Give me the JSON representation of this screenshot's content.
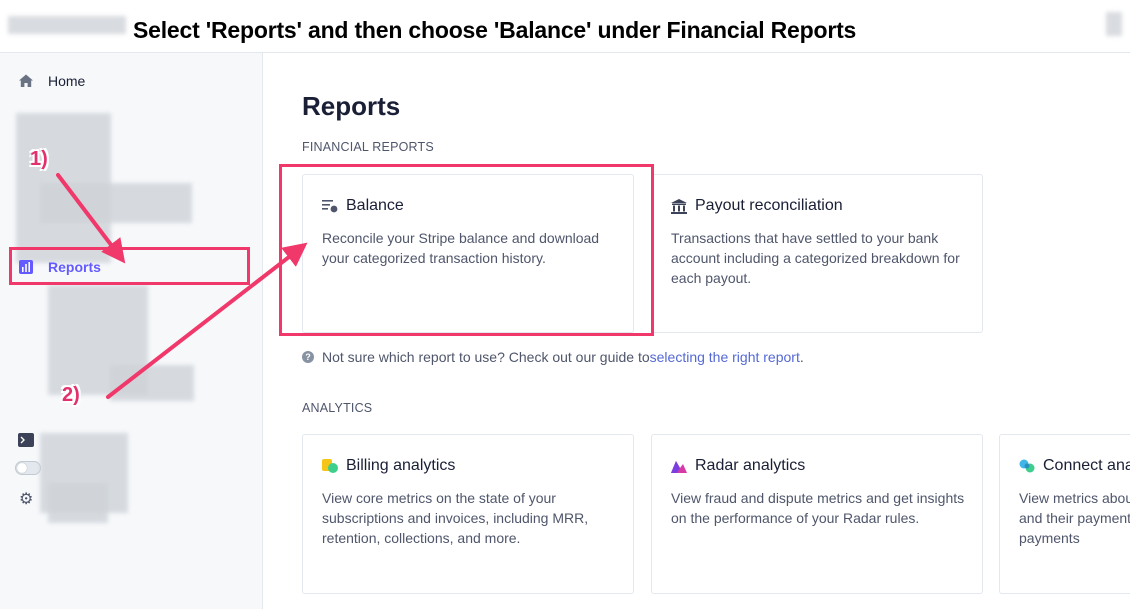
{
  "instruction": "Select 'Reports' and then choose 'Balance' under Financial Reports",
  "sidebar": {
    "home_label": "Home",
    "reports_label": "Reports"
  },
  "main": {
    "page_title": "Reports",
    "financial_label": "FINANCIAL REPORTS",
    "analytics_label": "ANALYTICS",
    "cards": {
      "balance": {
        "title": "Balance",
        "desc": "Reconcile your Stripe balance and download your categorized transaction history."
      },
      "payout": {
        "title": "Payout reconciliation",
        "desc": "Transactions that have settled to your bank account including a categorized breakdown for each payout."
      },
      "billing": {
        "title": "Billing analytics",
        "desc": "View core metrics on the state of your subscriptions and invoices, including MRR, retention, collections, and more."
      },
      "radar": {
        "title": "Radar analytics",
        "desc": "View fraud and dispute metrics and get insights on the performance of your Radar rules."
      },
      "connect": {
        "title": "Connect analytics",
        "desc": "View metrics about your connected accounts and their payments, including successful payments"
      }
    },
    "help_text": "Not sure which report to use? Check out our guide to ",
    "help_link": "selecting the right report",
    "help_end": "."
  },
  "annotations": {
    "step1": "1)",
    "step2": "2)"
  },
  "colors": {
    "accent": "#635bff",
    "highlight": "#f0386b",
    "link": "#5469d4"
  }
}
